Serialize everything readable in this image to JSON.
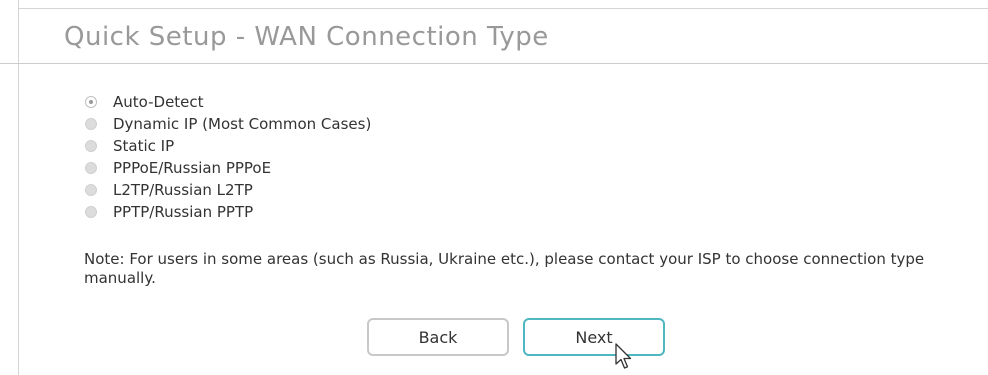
{
  "header": {
    "title": "Quick Setup - WAN Connection Type"
  },
  "options": [
    {
      "label": "Auto-Detect",
      "checked": true
    },
    {
      "label": "Dynamic IP (Most Common Cases)",
      "checked": false
    },
    {
      "label": "Static IP",
      "checked": false
    },
    {
      "label": "PPPoE/Russian PPPoE",
      "checked": false
    },
    {
      "label": "L2TP/Russian L2TP",
      "checked": false
    },
    {
      "label": "PPTP/Russian PPTP",
      "checked": false
    }
  ],
  "note": {
    "label": "Note:",
    "text": "For users in some areas (such as Russia, Ukraine etc.), please contact your ISP to choose connection type manually."
  },
  "buttons": {
    "back_label": "Back",
    "next_label": "Next"
  },
  "colors": {
    "accent": "#4fb7c2",
    "title_gray": "#999999"
  },
  "icons": {
    "cursor": "mouse-pointer-icon"
  }
}
